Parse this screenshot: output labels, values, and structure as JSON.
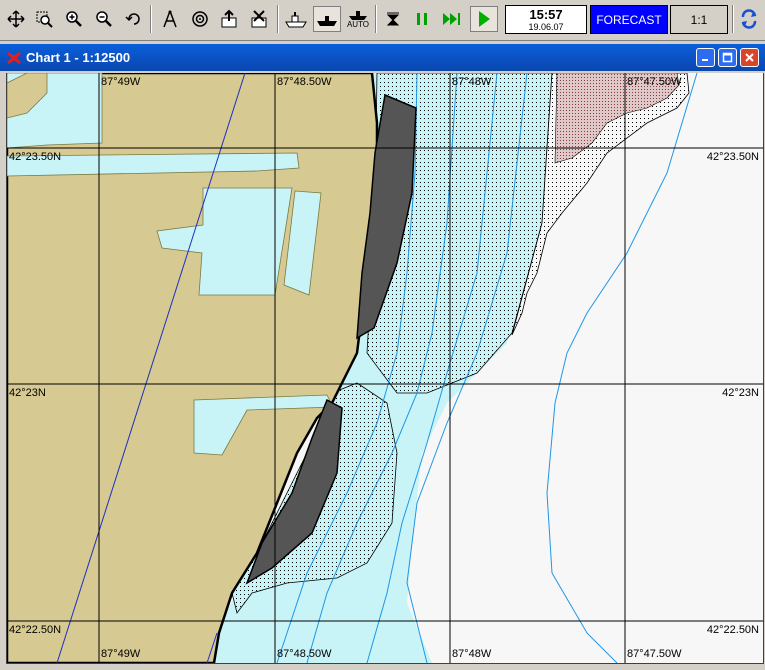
{
  "toolbar": {
    "clock_time": "15:57",
    "clock_date": "19.06.07",
    "forecast_label": "FORECAST",
    "scale_label": "1:1",
    "auto_label": "AUTO"
  },
  "window": {
    "title": "Chart 1 - 1:12500"
  },
  "chart": {
    "lon_top": [
      "87°49W",
      "87°48.50W",
      "87°48W",
      "87°47.50W"
    ],
    "lon_bottom": [
      "87°49W",
      "87°48.50W",
      "87°48W",
      "87°47.50W"
    ],
    "lat_left": [
      "42°23.50N",
      "42°23N",
      "42°22.50N"
    ],
    "lat_right": [
      "42°23.50N",
      "42°23N",
      "42°22.50N"
    ],
    "colors": {
      "land": "#d6c992",
      "shallow": "#c8f4f8",
      "deep": "#f7f7f7",
      "contour": "#1e96e6",
      "grid": "#000000"
    }
  }
}
